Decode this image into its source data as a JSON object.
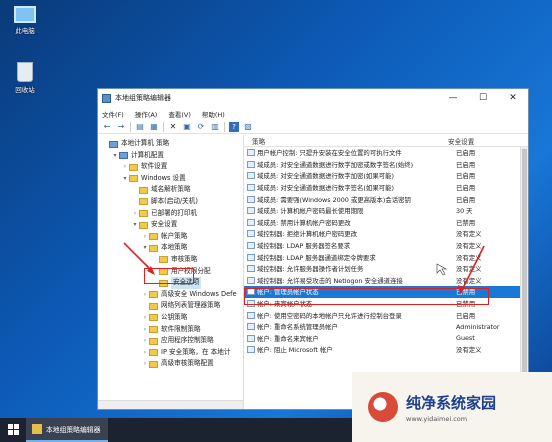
{
  "desktop": {
    "icons": [
      {
        "label": "此电脑",
        "icon": "computer-icon"
      },
      {
        "label": "回收站",
        "icon": "recycle-bin-icon"
      }
    ]
  },
  "window": {
    "title": "本地组策略编辑器",
    "controls": {
      "minimize": "—",
      "maximize": "☐",
      "close": "✕"
    },
    "menu": [
      "文件(F)",
      "操作(A)",
      "查看(V)",
      "帮助(H)"
    ],
    "toolbar": [
      "back-arrow-icon",
      "forward-arrow-icon",
      "folder-up-icon",
      "show-tree-icon",
      "delete-icon",
      "properties-icon",
      "refresh-icon",
      "export-icon",
      "help-icon",
      "filter-icon"
    ]
  },
  "tree": [
    {
      "label": "本地计算机 策略",
      "level": 0,
      "toggle": "",
      "folder": "blue"
    },
    {
      "label": "计算机配置",
      "level": 1,
      "toggle": "▾",
      "folder": "blue"
    },
    {
      "label": "软件设置",
      "level": 2,
      "toggle": "›",
      "folder": "yellow"
    },
    {
      "label": "Windows 设置",
      "level": 2,
      "toggle": "▾",
      "folder": "yellow"
    },
    {
      "label": "域名解析策略",
      "level": 3,
      "toggle": "",
      "folder": "yellow"
    },
    {
      "label": "脚本(启动/关机)",
      "level": 3,
      "toggle": "",
      "folder": "yellow"
    },
    {
      "label": "已部署的打印机",
      "level": 3,
      "toggle": "›",
      "folder": "yellow"
    },
    {
      "label": "安全设置",
      "level": 3,
      "toggle": "▾",
      "folder": "yellow"
    },
    {
      "label": "帐户策略",
      "level": 4,
      "toggle": "›",
      "folder": "yellow"
    },
    {
      "label": "本地策略",
      "level": 4,
      "toggle": "▾",
      "folder": "yellow"
    },
    {
      "label": "审核策略",
      "level": 5,
      "toggle": "",
      "folder": "yellow"
    },
    {
      "label": "用户权限分配",
      "level": 5,
      "toggle": "",
      "folder": "yellow"
    },
    {
      "label": "安全选项",
      "level": 5,
      "toggle": "",
      "folder": "yellow",
      "selected": true
    },
    {
      "label": "高级安全 Windows Defe",
      "level": 4,
      "toggle": "›",
      "folder": "yellow"
    },
    {
      "label": "网络列表管理器策略",
      "level": 4,
      "toggle": "",
      "folder": "yellow"
    },
    {
      "label": "公钥策略",
      "level": 4,
      "toggle": "›",
      "folder": "yellow"
    },
    {
      "label": "软件限制策略",
      "level": 4,
      "toggle": "›",
      "folder": "yellow"
    },
    {
      "label": "应用程序控制策略",
      "level": 4,
      "toggle": "›",
      "folder": "yellow"
    },
    {
      "label": "IP 安全策略，在 本地计",
      "level": 4,
      "toggle": "›",
      "folder": "yellow"
    },
    {
      "label": "高级审核策略配置",
      "level": 4,
      "toggle": "›",
      "folder": "yellow"
    }
  ],
  "list": {
    "columns": {
      "policy": "策略",
      "setting": "安全设置"
    },
    "rows": [
      {
        "policy": "用户帐户控制: 只提升安装在安全位置的可执行文件",
        "setting": "已启用"
      },
      {
        "policy": "域成员: 对安全通道数据进行数字加密或数字签名(始终)",
        "setting": "已启用"
      },
      {
        "policy": "域成员: 对安全通道数据进行数字加密(如果可能)",
        "setting": "已启用"
      },
      {
        "policy": "域成员: 对安全通道数据进行数字签名(如果可能)",
        "setting": "已启用"
      },
      {
        "policy": "域成员: 需要强(Windows 2000 或更高版本)会话密钥",
        "setting": "已启用"
      },
      {
        "policy": "域成员: 计算机帐户密码最长使用期限",
        "setting": "30 天"
      },
      {
        "policy": "域成员: 禁用计算机帐户密码更改",
        "setting": "已禁用"
      },
      {
        "policy": "域控制器: 拒绝计算机帐户密码更改",
        "setting": "没有定义"
      },
      {
        "policy": "域控制器: LDAP 服务器签名要求",
        "setting": "没有定义"
      },
      {
        "policy": "域控制器: LDAP 服务器通道绑定令牌要求",
        "setting": "没有定义"
      },
      {
        "policy": "域控制器: 允许服务器操作者计划任务",
        "setting": "没有定义"
      },
      {
        "policy": "域控制器: 允许易受攻击的 Netlogon 安全通道连接",
        "setting": "没有定义"
      },
      {
        "policy": "帐户: 管理员帐户状态",
        "setting": "已禁用",
        "selected": true
      },
      {
        "policy": "帐户: 来宾帐户状态",
        "setting": "已禁用"
      },
      {
        "policy": "帐户: 使用空密码的本地帐户只允许进行控制台登录",
        "setting": "已启用"
      },
      {
        "policy": "帐户: 重命名系统管理员帐户",
        "setting": "Administrator"
      },
      {
        "policy": "帐户: 重命名来宾帐户",
        "setting": "Guest"
      },
      {
        "policy": "帐户: 阻止 Microsoft 帐户",
        "setting": "没有定义"
      }
    ]
  },
  "taskbar": {
    "task_label": "本地组策略编辑器"
  },
  "watermark": {
    "title": "纯净系统家园",
    "url": "www.yidaimei.com"
  },
  "colors": {
    "selection": "#1a79d6",
    "annotation": "#e02020"
  }
}
